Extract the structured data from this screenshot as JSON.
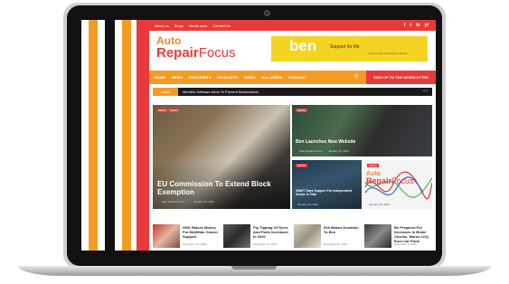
{
  "topbar": {
    "links": [
      "About us",
      "Blogs",
      "Media pack",
      "Contact Us"
    ],
    "social": [
      "f",
      "t",
      "in",
      "yt"
    ]
  },
  "logo": {
    "line1": "Auto",
    "line2a": "Repair",
    "line2b": "Focus"
  },
  "ad": {
    "brand": "ben",
    "tagline": "Support for life",
    "sub": "Here for the automotive industry"
  },
  "nav": {
    "items": [
      "HOME",
      "NEWS",
      "FEATURES ▾",
      "PRODUCTS",
      "VIDEO",
      "GALLERIES",
      "PODCAST"
    ],
    "newsletter": "SIGN UP TO THE NEWSLETTER"
  },
  "ticker": {
    "label": "Latest",
    "text": "Meritels Software Aims To Prevent Breakdowns"
  },
  "main_story": {
    "badges": [
      "NEWS",
      "NEWS"
    ],
    "title": "EU Commission To Extend Block Exemption",
    "author": "Auto Repair Focus",
    "date": "January 13, 2021"
  },
  "story2": {
    "badge": "NEWS",
    "title": "Ben Launches New Website",
    "author": "Auto Repair Focus",
    "date": "January 13, 2021"
  },
  "story3": {
    "badge": "NEWS",
    "title": "SMMT Says Support For Independent Sector Is Vital",
    "date": "January 13, 2021"
  },
  "story4": {
    "badge": "NEWS",
    "date": "January 13, 2021"
  },
  "bottom": [
    {
      "title": "HGK Raises Money For McMillan Cancer Support",
      "date": "December 21, 2020"
    },
    {
      "title": "Fly-Tipping Of Tyres And Parts Increased In 2020",
      "date": "December 21, 2021"
    },
    {
      "title": "IGA Makes Donation To Ben",
      "date": "December 20, 2021"
    },
    {
      "title": "Be Prepared For Increases In Brake Checks, Warns LKQ Euro Car Parts",
      "date": "December 9, 2021"
    }
  ],
  "colors": {
    "red": "#e83a3a",
    "orange": "#f39c23",
    "yellow": "#f5d321"
  }
}
